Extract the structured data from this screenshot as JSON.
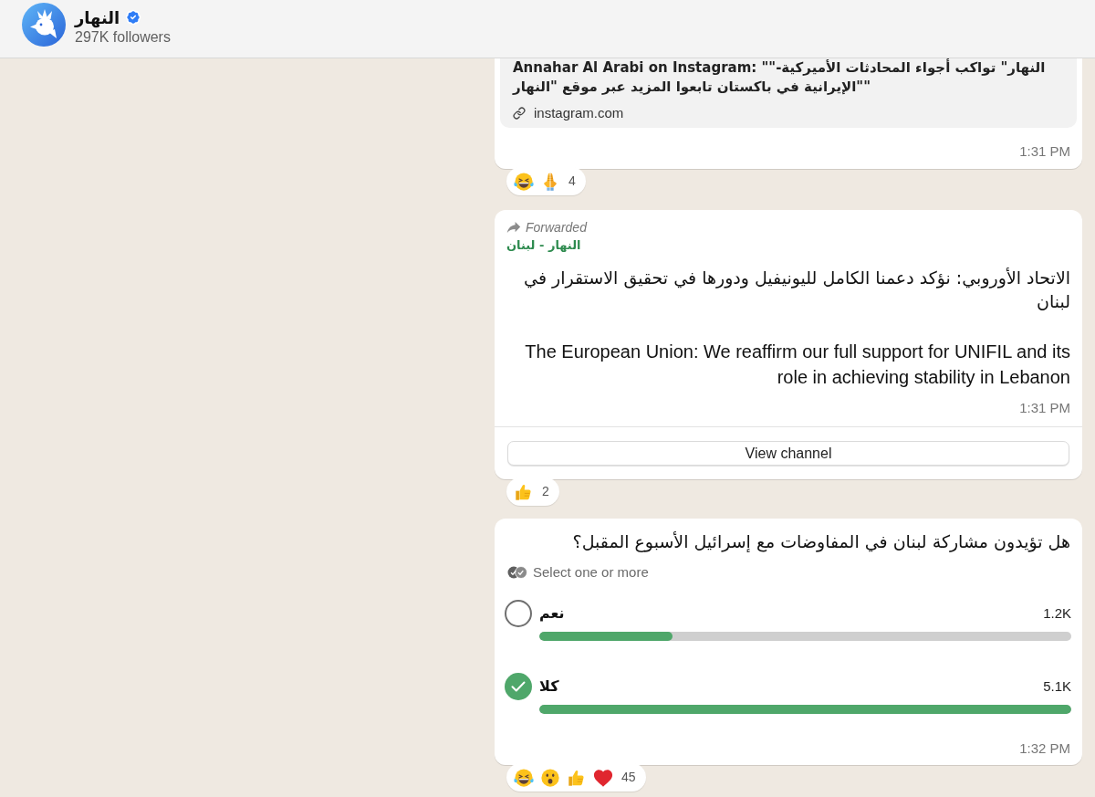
{
  "header": {
    "channel_name": "النهار",
    "verified": true,
    "followers": "297K followers"
  },
  "messages": [
    {
      "kind": "link",
      "preview": {
        "title": "Annahar Al Arabi on Instagram: \"\"النهار\" تواكب أجواء المحادثات الأميركية- الإيرانية في باكستان تابعوا المزيد عبر موقع \"النهار\"\"",
        "domain": "instagram.com"
      },
      "time": "1:31 PM",
      "reactions": {
        "emojis": [
          {
            "kind": "laughing"
          },
          {
            "kind": "praying"
          }
        ],
        "count": "4"
      }
    },
    {
      "kind": "forwarded",
      "forwarded_label": "Forwarded",
      "source": "النهار - لبنان",
      "paragraphs": [
        {
          "kind": "arabic",
          "text": "الاتحاد الأوروبي: نؤكد دعمنا الكامل لليونيفيل ودورها في تحقيق الاستقرار في لبنان"
        },
        {
          "kind": "latin",
          "text": "The European Union: We reaffirm our full support for UNIFIL and its role in achieving stability in Lebanon"
        }
      ],
      "time": "1:31 PM",
      "button": "View channel",
      "reactions": {
        "emojis": [
          {
            "kind": "thumbs_up"
          }
        ],
        "count": "2"
      }
    },
    {
      "kind": "poll",
      "question": "هل تؤيدون مشاركة لبنان في المفاوضات مع إسرائيل الأسبوع المقبل؟",
      "hint": "Select one or more",
      "options": [
        {
          "label": "نعم",
          "votes": "1.2K",
          "level": 0.25,
          "selected": false
        },
        {
          "label": "كلا",
          "votes": "5.1K",
          "level": 1,
          "selected": true
        }
      ],
      "time": "1:32 PM",
      "reactions": {
        "emojis": [
          {
            "kind": "laughing"
          },
          {
            "kind": "surprised"
          },
          {
            "kind": "thumbs_up"
          },
          {
            "kind": "heart"
          }
        ],
        "count": "45"
      }
    }
  ]
}
